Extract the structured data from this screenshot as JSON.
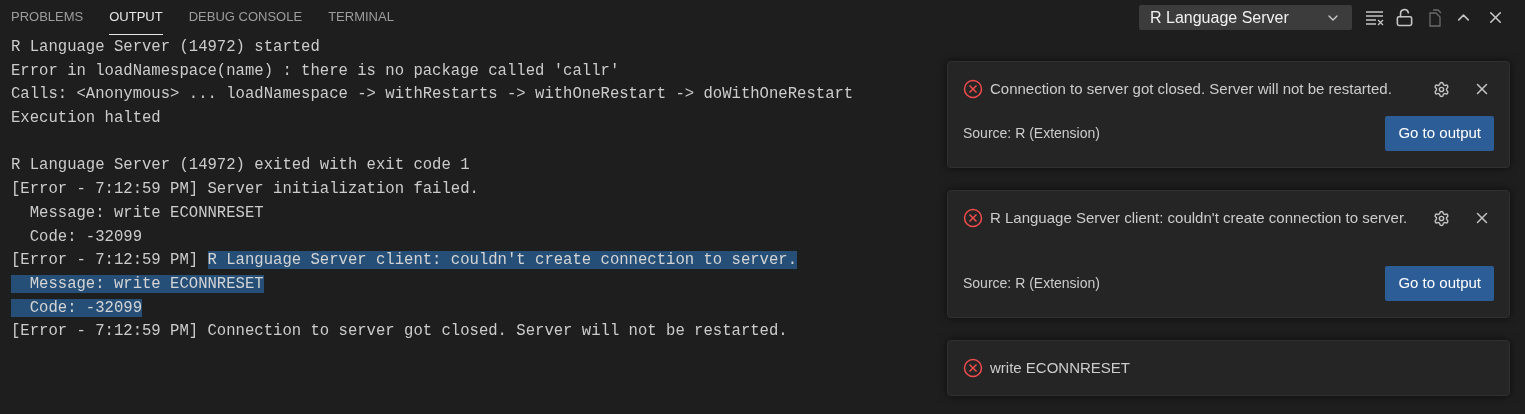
{
  "tabs": [
    {
      "label": "PROBLEMS",
      "selected": false
    },
    {
      "label": "OUTPUT",
      "selected": true
    },
    {
      "label": "DEBUG CONSOLE",
      "selected": false
    },
    {
      "label": "TERMINAL",
      "selected": false
    }
  ],
  "channel_select": {
    "value": "R Language Server"
  },
  "output_lines": [
    {
      "kind": "text",
      "segments": [
        {
          "text": "R Language Server (14972) started",
          "selected": false
        }
      ]
    },
    {
      "kind": "text",
      "segments": [
        {
          "text": "Error in loadNamespace(name) : there is no package called 'callr'",
          "selected": false
        }
      ]
    },
    {
      "kind": "text",
      "segments": [
        {
          "text": "Calls: <Anonymous> ... loadNamespace -> withRestarts -> withOneRestart -> doWithOneRestart",
          "selected": false
        }
      ]
    },
    {
      "kind": "text",
      "segments": [
        {
          "text": "Execution halted",
          "selected": false
        }
      ]
    },
    {
      "kind": "blank"
    },
    {
      "kind": "text",
      "segments": [
        {
          "text": "R Language Server (14972) exited with exit code 1",
          "selected": false
        }
      ]
    },
    {
      "kind": "text",
      "segments": [
        {
          "text": "[Error - 7:12:59 PM] Server initialization failed.",
          "selected": false
        }
      ]
    },
    {
      "kind": "text",
      "segments": [
        {
          "text": "  Message: write ECONNRESET",
          "selected": false
        }
      ]
    },
    {
      "kind": "text",
      "segments": [
        {
          "text": "  Code: -32099",
          "selected": false
        }
      ]
    },
    {
      "kind": "text",
      "segments": [
        {
          "text": "[Error - 7:12:59 PM] ",
          "selected": false
        },
        {
          "text": "R Language Server client: couldn't create connection to server.",
          "selected": true
        }
      ]
    },
    {
      "kind": "text",
      "segments": [
        {
          "text": "  Message: write ECONNRESET",
          "selected": true
        }
      ]
    },
    {
      "kind": "text",
      "segments": [
        {
          "text": "  Code: -32099",
          "selected": true
        }
      ]
    },
    {
      "kind": "text",
      "segments": [
        {
          "text": "[Error - 7:12:59 PM] Connection to server got closed. Server will not be restarted.",
          "selected": false
        }
      ]
    }
  ],
  "notifications": [
    {
      "message": "Connection to server got closed. Server will not be restarted.",
      "source": "Source: R (Extension)",
      "action": "Go to output"
    },
    {
      "message": "R Language Server client: couldn't create connection to server.",
      "source": "Source: R (Extension)",
      "action": "Go to output"
    },
    {
      "message": "write ECONNRESET"
    }
  ]
}
